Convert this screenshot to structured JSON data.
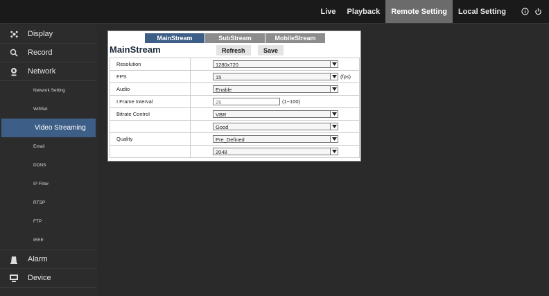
{
  "topnav": {
    "tabs": [
      {
        "label": "Live",
        "active": false
      },
      {
        "label": "Playback",
        "active": false
      },
      {
        "label": "Remote Setting",
        "active": true
      },
      {
        "label": "Local Setting",
        "active": false
      }
    ],
    "icons": [
      "info-icon",
      "power-icon"
    ]
  },
  "sidebar": {
    "main": [
      {
        "label": "Display",
        "icon": "display-icon"
      },
      {
        "label": "Record",
        "icon": "search-icon"
      },
      {
        "label": "Network",
        "icon": "network-icon"
      },
      {
        "label": "Alarm",
        "icon": "alarm-icon"
      },
      {
        "label": "Device",
        "icon": "device-icon"
      }
    ],
    "network_sub": [
      "Network Setting",
      "WifiSet",
      "Video Streaming",
      "Email",
      "DDNS",
      "IP Filter",
      "RTSP",
      "FTP",
      "IEEE"
    ],
    "active_sub": "Video Streaming"
  },
  "panel": {
    "stream_tabs": [
      {
        "label": "MainStream",
        "active": true
      },
      {
        "label": "SubStream",
        "active": false
      },
      {
        "label": "MobileStream",
        "active": false
      }
    ],
    "title": "MainStream",
    "refresh_label": "Refresh",
    "save_label": "Save",
    "rows": {
      "resolution": {
        "label": "Resolution",
        "value": "1280x720"
      },
      "fps": {
        "label": "FPS",
        "value": "15",
        "unit": "(fps)"
      },
      "audio": {
        "label": "Audio",
        "value": "Enable"
      },
      "iframe": {
        "label": "I Frame Interval",
        "value": "25",
        "hint": "(1~100)"
      },
      "bitrate_control": {
        "label": "Bitrate Control",
        "value": "VBR"
      },
      "bitrate_quality": {
        "label": "",
        "value": "Good"
      },
      "quality": {
        "label": "Quality",
        "value": "Pre_Defined"
      },
      "bitrate": {
        "label": "",
        "value": "2048"
      }
    }
  },
  "colors": {
    "accent": "#3d5e86",
    "active_top_tab": "#6b6b6b",
    "background": "#2a2a2a"
  }
}
